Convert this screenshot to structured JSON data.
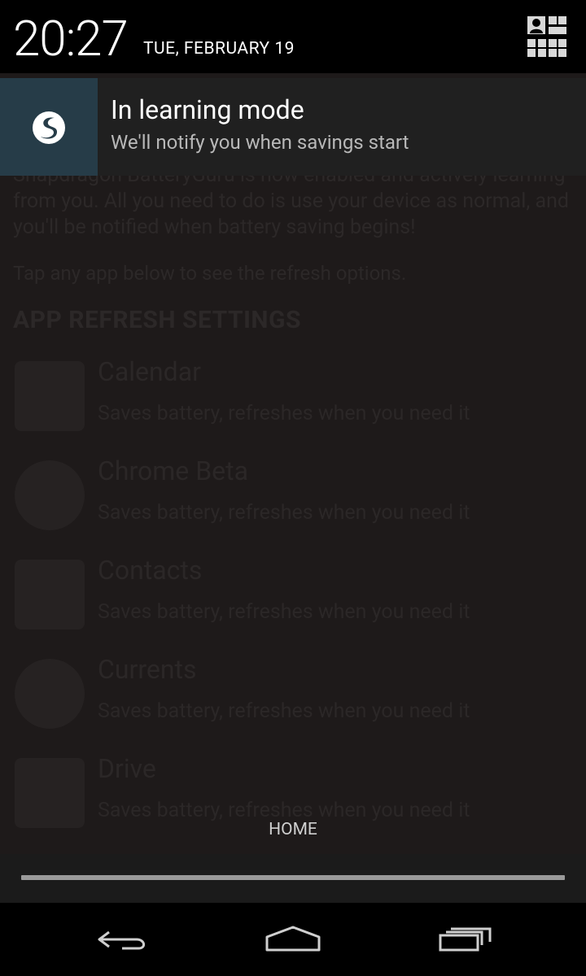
{
  "status_bar": {
    "time": "20:27",
    "date": "TUE, FEBRUARY 19",
    "quick_settings_icon": "quick-settings-icon"
  },
  "notification": {
    "icon": "snapdragon-battery-guru-icon",
    "title": "In learning mode",
    "text": "We'll notify you when savings start",
    "colors": {
      "icon_bg": "#263c48",
      "card_bg": "#202020"
    }
  },
  "background_app": {
    "paragraph": "Snapdragon BatteryGuru is now enabled and actively learning from you. All you need to do is use your device as normal, and you'll be notified when battery saving begins!",
    "tap_hint": "Tap any app below to see the refresh options.",
    "section_title": "APP REFRESH SETTINGS",
    "apps": [
      {
        "name": "Calendar",
        "desc": "Saves battery, refreshes when you need it",
        "icon": "calendar-icon"
      },
      {
        "name": "Chrome Beta",
        "desc": "Saves battery, refreshes when you need it",
        "icon": "chrome-beta-icon"
      },
      {
        "name": "Contacts",
        "desc": "Saves battery, refreshes when you need it",
        "icon": "contacts-icon"
      },
      {
        "name": "Currents",
        "desc": "Saves battery, refreshes when you need it",
        "icon": "currents-icon"
      },
      {
        "name": "Drive",
        "desc": "Saves battery, refreshes when you need it",
        "icon": "drive-icon"
      }
    ]
  },
  "home_label": "HOME",
  "nav_bar": {
    "back": "back-icon",
    "home": "home-icon",
    "recents": "recents-icon"
  }
}
